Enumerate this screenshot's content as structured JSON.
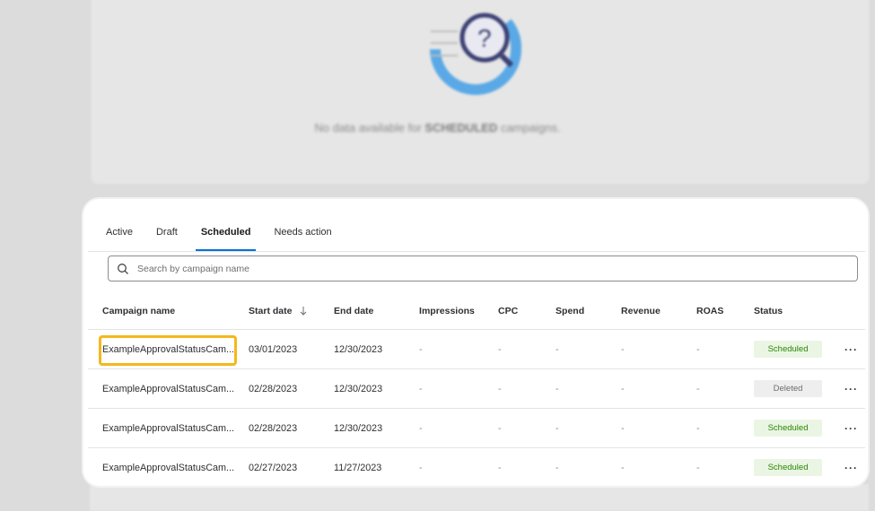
{
  "background": {
    "message_prefix": "No data available for",
    "message_bold": "SCHEDULED",
    "message_suffix": "campaigns."
  },
  "tabs": [
    {
      "label": "Active"
    },
    {
      "label": "Draft"
    },
    {
      "label": "Scheduled",
      "active": true
    },
    {
      "label": "Needs action"
    }
  ],
  "search": {
    "placeholder": "Search by campaign name",
    "value": ""
  },
  "table": {
    "headers": {
      "campaign_name": "Campaign name",
      "start_date": "Start date",
      "end_date": "End date",
      "impressions": "Impressions",
      "cpc": "CPC",
      "spend": "Spend",
      "revenue": "Revenue",
      "roas": "ROAS",
      "status": "Status"
    },
    "rows": [
      {
        "name": "ExampleApprovalStatusCam...",
        "start": "03/01/2023",
        "end": "12/30/2023",
        "impressions": "-",
        "cpc": "-",
        "spend": "-",
        "revenue": "-",
        "roas": "-",
        "status": "Scheduled",
        "more": "···"
      },
      {
        "name": "ExampleApprovalStatusCam...",
        "start": "02/28/2023",
        "end": "12/30/2023",
        "impressions": "-",
        "cpc": "-",
        "spend": "-",
        "revenue": "-",
        "roas": "-",
        "status": "Deleted",
        "more": "···"
      },
      {
        "name": "ExampleApprovalStatusCam...",
        "start": "02/28/2023",
        "end": "12/30/2023",
        "impressions": "-",
        "cpc": "-",
        "spend": "-",
        "revenue": "-",
        "roas": "-",
        "status": "Scheduled",
        "more": "···"
      },
      {
        "name": "ExampleApprovalStatusCam...",
        "start": "02/27/2023",
        "end": "11/27/2023",
        "impressions": "-",
        "cpc": "-",
        "spend": "-",
        "revenue": "-",
        "roas": "-",
        "status": "Scheduled",
        "more": "···"
      }
    ]
  },
  "colors": {
    "accent": "#0071dc",
    "highlight": "#f4b81d",
    "scheduled_bg": "#eaf5e4",
    "scheduled_text": "#2a8703",
    "deleted_bg": "#eeeeee"
  },
  "icons": {
    "search": "search-icon",
    "sort": "arrow-down-icon",
    "more": "more-horizontal-icon",
    "illustration": "magnifier-question-icon"
  }
}
